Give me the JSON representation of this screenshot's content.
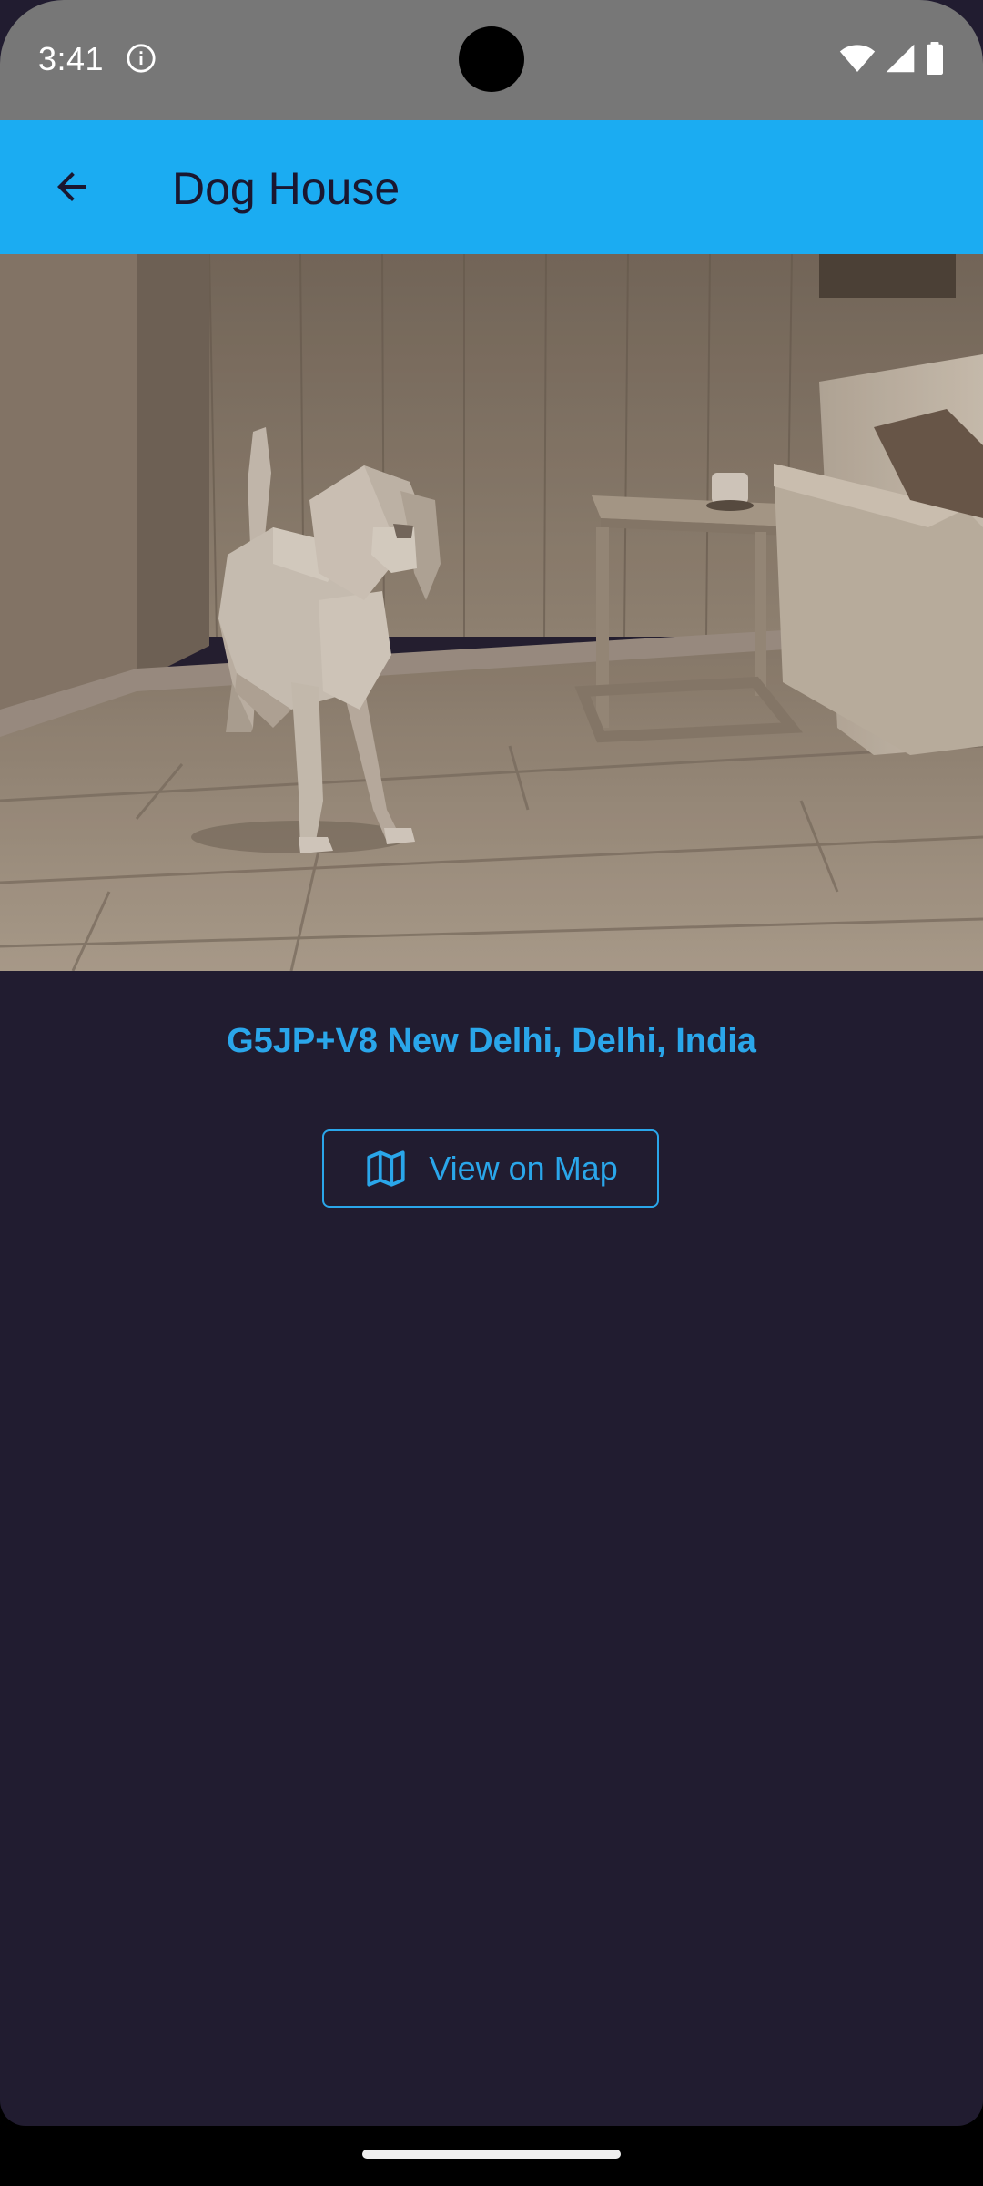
{
  "status_bar": {
    "time": "3:41",
    "icons": [
      "info-icon",
      "wifi-icon",
      "signal-icon",
      "battery-icon"
    ]
  },
  "app_bar": {
    "title": "Dog House",
    "back_icon": "arrow-back-icon",
    "color": "#1bacf2"
  },
  "hero_image": {
    "description_icon": "dog-room-image"
  },
  "location": {
    "address": "G5JP+V8 New Delhi, Delhi, India",
    "map_button_label": "View on Map",
    "map_button_icon": "map-icon",
    "accent_color": "#2aa6ea"
  },
  "theme": {
    "background": "#211c30"
  }
}
